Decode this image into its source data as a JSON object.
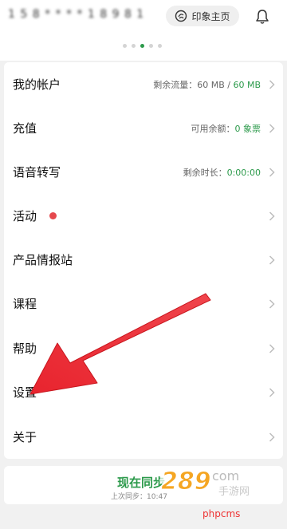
{
  "header": {
    "account_masked": "1 5 8 * * * * 1 8 9 8 1",
    "home_button_label": "印象主页"
  },
  "carousel": {
    "dots": 5,
    "active_index": 2
  },
  "menu": {
    "items": [
      {
        "label": "我的帐户",
        "info_prefix": "剩余流量：",
        "info_main": "60 MB / ",
        "info_value": "60 MB"
      },
      {
        "label": "充值",
        "info_prefix": "可用余额：",
        "info_main": "",
        "info_value": "0 象票"
      },
      {
        "label": "语音转写",
        "info_prefix": "剩余时长：",
        "info_main": "",
        "info_value": "0:00:00"
      },
      {
        "label": "活动",
        "has_badge": true
      },
      {
        "label": "产品情报站"
      },
      {
        "label": "课程"
      },
      {
        "label": "帮助"
      },
      {
        "label": "设置"
      },
      {
        "label": "关于"
      }
    ]
  },
  "sync": {
    "title": "现在同步",
    "subtitle": "上次同步：10:47"
  },
  "watermark": {
    "logo_text": "289",
    "logo_suffix": "com",
    "logo_cn": "手游网",
    "text": "phpcms"
  },
  "colors": {
    "accent": "#2c9a4b",
    "badge": "#e5484d",
    "arrow": "#e8242e"
  }
}
